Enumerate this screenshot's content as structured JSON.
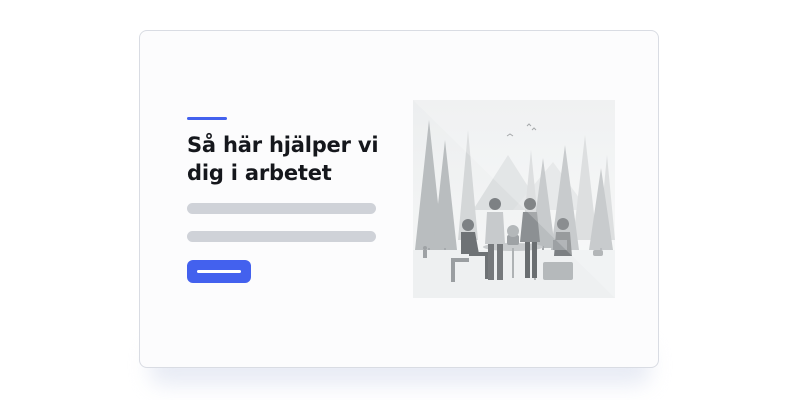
{
  "card": {
    "heading": "Så här hjälper vi dig i arbetet"
  },
  "colors": {
    "accent": "#4361ee",
    "placeholder_bar": "#cfd2d8",
    "heading_text": "#15171c",
    "card_border": "#d9dce3"
  },
  "illustration": {
    "icon": "team-meeting-forest-illustration"
  },
  "icons": {
    "accent": "accent-line",
    "button_label": "placeholder-bar"
  }
}
